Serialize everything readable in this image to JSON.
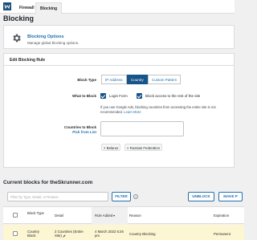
{
  "tabs": {
    "firewall": "Firewall",
    "blocking": "Blocking"
  },
  "page_title": "Blocking",
  "options": {
    "title": "Blocking Options",
    "subtitle": "Manage global blocking options."
  },
  "edit_rule": {
    "title": "Edit Blocking Rule",
    "block_type_label": "Block Type",
    "block_types": [
      "IP Address",
      "Country",
      "Custom Pattern"
    ],
    "selected_block_type": "Country",
    "what_to_block_label": "What to Block",
    "login_form_label": "Login Form",
    "login_form_checked": true,
    "rest_of_site_label": "Block access to the rest of the site",
    "rest_of_site_checked": true,
    "note_text": "If you use Google Ads, blocking countries from accessing the entire site is not recommended.",
    "note_link": "Learn More",
    "countries_label": "Countries to Block",
    "pick_from_list": "Pick from List",
    "selected_countries": [
      "Belarus",
      "Russian Federation"
    ],
    "remove_symbol": "×"
  },
  "current_blocks": {
    "title": "Current blocks for theSkrunner.com",
    "filter_placeholder": "Filter by Type, Detail, or Reason",
    "filter_button": "FILTER",
    "help_symbol": "?",
    "unblock_button": "UNBLOCK",
    "make_button": "MAKE P"
  },
  "table": {
    "headers": {
      "block_type": "Block Type",
      "detail": "Detail",
      "rule_added": "Rule Added",
      "reason": "Reason",
      "expiration": "Expiration"
    },
    "rows": [
      {
        "block_type": "Country Block",
        "detail": "2 Countries (Entire Site)",
        "rule_added": "4 March 2022 6:26 pm",
        "reason": "Country Blocking",
        "expiration": "Permanent"
      }
    ]
  },
  "colors": {
    "accent": "#16548a",
    "link": "#2271b1",
    "highlight_row": "#fdf6d3",
    "background": "#f0f0f1"
  }
}
